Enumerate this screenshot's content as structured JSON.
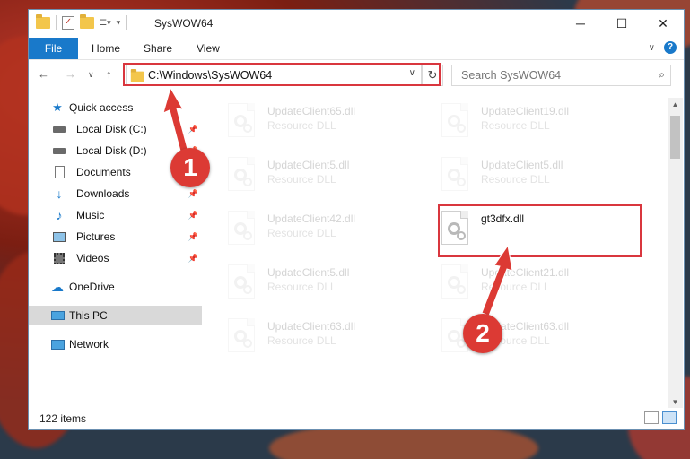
{
  "window": {
    "title": "SysWOW64",
    "controls": {
      "minimize": "─",
      "maximize": "☐",
      "close": "✕"
    }
  },
  "ribbon": {
    "file": "File",
    "tabs": [
      "Home",
      "Share",
      "View"
    ]
  },
  "navigation": {
    "address_path": "C:\\Windows\\SysWOW64",
    "search_placeholder": "Search SysWOW64"
  },
  "sidebar": {
    "items": [
      {
        "label": "Quick access",
        "icon": "star-icon",
        "pinned": false
      },
      {
        "label": "Local Disk (C:)",
        "icon": "drive-icon",
        "pinned": true
      },
      {
        "label": "Local Disk (D:)",
        "icon": "drive-icon",
        "pinned": true
      },
      {
        "label": "Documents",
        "icon": "documents-icon",
        "pinned": true
      },
      {
        "label": "Downloads",
        "icon": "download-icon",
        "pinned": true
      },
      {
        "label": "Music",
        "icon": "music-icon",
        "pinned": true
      },
      {
        "label": "Pictures",
        "icon": "pictures-icon",
        "pinned": true
      },
      {
        "label": "Videos",
        "icon": "videos-icon",
        "pinned": true
      },
      {
        "label": "OneDrive",
        "icon": "cloud-icon",
        "pinned": false
      },
      {
        "label": "This PC",
        "icon": "computer-icon",
        "pinned": false,
        "selected": true
      },
      {
        "label": "Network",
        "icon": "network-icon",
        "pinned": false
      }
    ]
  },
  "files": [
    {
      "name": "UpdateClient65.dll",
      "type": "Resource DLL",
      "faded": true
    },
    {
      "name": "UpdateClient19.dll",
      "type": "Resource DLL",
      "faded": true
    },
    {
      "name": "UpdateClient5.dll",
      "type": "Resource DLL",
      "faded": true
    },
    {
      "name": "UpdateClient5.dll",
      "type": "Resource DLL",
      "faded": true
    },
    {
      "name": "UpdateClient42.dll",
      "type": "Resource DLL",
      "faded": true
    },
    {
      "name": "gt3dfx.dll",
      "type": "",
      "faded": false,
      "highlighted": true
    },
    {
      "name": "UpdateClient5.dll",
      "type": "Resource DLL",
      "faded": true
    },
    {
      "name": "UpdateClient21.dll",
      "type": "Resource DLL",
      "faded": true
    },
    {
      "name": "UpdateClient63.dll",
      "type": "Resource DLL",
      "faded": true
    },
    {
      "name": "UpdateClient63.dll",
      "type": "Resource DLL",
      "faded": true
    }
  ],
  "status": {
    "item_count": "122 items"
  },
  "annotations": {
    "step1": "1",
    "step2": "2",
    "highlight_color": "#d9363e"
  }
}
